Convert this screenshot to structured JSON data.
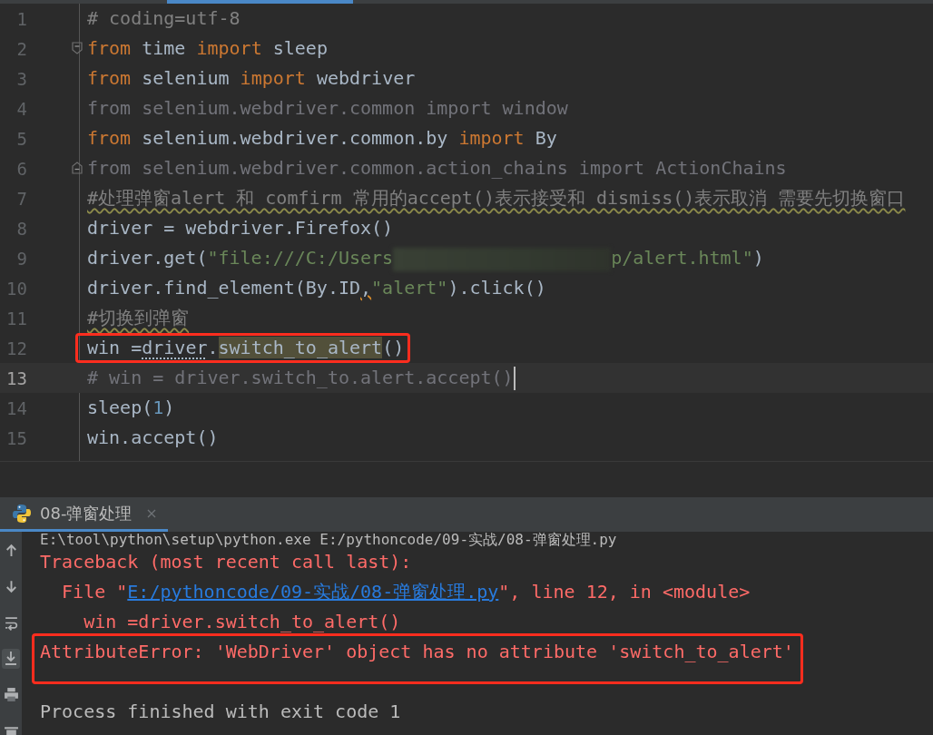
{
  "editor": {
    "lines": [
      {
        "number": "1",
        "current": false,
        "boxed": false,
        "tokens": [
          {
            "text": "# coding=utf-8",
            "kind": "comment"
          }
        ]
      },
      {
        "number": "2",
        "current": false,
        "boxed": false,
        "fold_start": true,
        "tokens": [
          {
            "text": "from",
            "kind": "keyword"
          },
          {
            "text": " time ",
            "kind": "plain"
          },
          {
            "text": "import",
            "kind": "keyword"
          },
          {
            "text": " sleep",
            "kind": "plain"
          }
        ]
      },
      {
        "number": "3",
        "current": false,
        "boxed": false,
        "tokens": [
          {
            "text": "from",
            "kind": "keyword"
          },
          {
            "text": " selenium ",
            "kind": "plain"
          },
          {
            "text": "import",
            "kind": "keyword"
          },
          {
            "text": " webdriver",
            "kind": "plain"
          }
        ]
      },
      {
        "number": "4",
        "current": false,
        "boxed": false,
        "tokens": [
          {
            "text": "from selenium.webdriver.common import window",
            "kind": "unused"
          }
        ]
      },
      {
        "number": "5",
        "current": false,
        "boxed": false,
        "tokens": [
          {
            "text": "from",
            "kind": "keyword"
          },
          {
            "text": " selenium.webdriver.common.by ",
            "kind": "plain"
          },
          {
            "text": "import",
            "kind": "keyword"
          },
          {
            "text": " By",
            "kind": "plain"
          }
        ]
      },
      {
        "number": "6",
        "current": false,
        "boxed": false,
        "fold_end": true,
        "tokens": [
          {
            "text": "from selenium.webdriver.common.action_chains import ActionChains",
            "kind": "unused"
          }
        ]
      },
      {
        "number": "7",
        "current": false,
        "boxed": false,
        "tokens": [
          {
            "text": "#处理弹窗alert 和 comfirm 常用的accept()表示接受和 dismiss()表示取消 需要先切换窗口",
            "kind": "typo"
          }
        ]
      },
      {
        "number": "8",
        "current": false,
        "boxed": false,
        "tokens": [
          {
            "text": "driver = webdriver.Firefox()",
            "kind": "plain"
          }
        ]
      },
      {
        "number": "9",
        "current": false,
        "boxed": false,
        "tokens": [
          {
            "text": "driver.get(",
            "kind": "plain"
          },
          {
            "text": "\"file:///C:/Users",
            "kind": "string"
          },
          {
            "kind": "redacted"
          },
          {
            "text": "p/alert.html\"",
            "kind": "string"
          },
          {
            "text": ")",
            "kind": "plain"
          }
        ]
      },
      {
        "number": "10",
        "current": false,
        "boxed": false,
        "tokens": [
          {
            "text": "driver.find_element(By.ID",
            "kind": "plain"
          },
          {
            "text": ",",
            "kind": "warning"
          },
          {
            "text": "\"alert\"",
            "kind": "string"
          },
          {
            "text": ").click()",
            "kind": "plain"
          }
        ]
      },
      {
        "number": "11",
        "current": false,
        "boxed": false,
        "tokens": [
          {
            "text": "#切换到弹窗",
            "kind": "typo"
          }
        ]
      },
      {
        "number": "12",
        "current": false,
        "boxed": true,
        "tokens": [
          {
            "text": "win =",
            "kind": "plain"
          },
          {
            "text": "driver",
            "kind": "dotted"
          },
          {
            "text": ".",
            "kind": "plain"
          },
          {
            "text": "switch_to_alert",
            "kind": "match"
          },
          {
            "text": "()",
            "kind": "plain"
          }
        ]
      },
      {
        "number": "13",
        "current": true,
        "boxed": false,
        "tokens": [
          {
            "text": "# win = driver.switch_to.alert.accept()",
            "kind": "unused"
          }
        ]
      },
      {
        "number": "14",
        "current": false,
        "boxed": false,
        "tokens": [
          {
            "text": "sleep(",
            "kind": "plain"
          },
          {
            "text": "1",
            "kind": "number"
          },
          {
            "text": ")",
            "kind": "plain"
          }
        ]
      },
      {
        "number": "15",
        "current": false,
        "boxed": false,
        "tokens": [
          {
            "text": "win.accept()",
            "kind": "plain"
          }
        ]
      }
    ]
  },
  "run_panel": {
    "tabs": [
      {
        "label": "08-弹窗处理",
        "selected": true
      }
    ],
    "console": [
      {
        "boxed": false,
        "tokens": [
          {
            "text": "E:\\tool\\python\\setup\\python.exe E:/pythoncode/09-实战/08-弹窗处理.py",
            "kind": "output"
          }
        ]
      },
      {
        "boxed": false,
        "tokens": [
          {
            "text": "Traceback (most recent call last):",
            "kind": "error"
          }
        ]
      },
      {
        "boxed": false,
        "tokens": [
          {
            "text": "  File \"",
            "kind": "error"
          },
          {
            "text": "E:/pythoncode/09-实战/08-弹窗处理.py",
            "kind": "link"
          },
          {
            "text": "\", line 12, in <module>",
            "kind": "error"
          }
        ]
      },
      {
        "boxed": false,
        "tokens": [
          {
            "text": "    win =driver.switch_to_alert()",
            "kind": "error"
          }
        ]
      },
      {
        "boxed": true,
        "tokens": [
          {
            "text": "AttributeError: 'WebDriver' object has no attribute 'switch_to_alert'",
            "kind": "error"
          }
        ]
      },
      {
        "boxed": false,
        "tokens": [
          {
            "text": "Process finished with exit code 1",
            "kind": "output"
          }
        ]
      }
    ]
  }
}
